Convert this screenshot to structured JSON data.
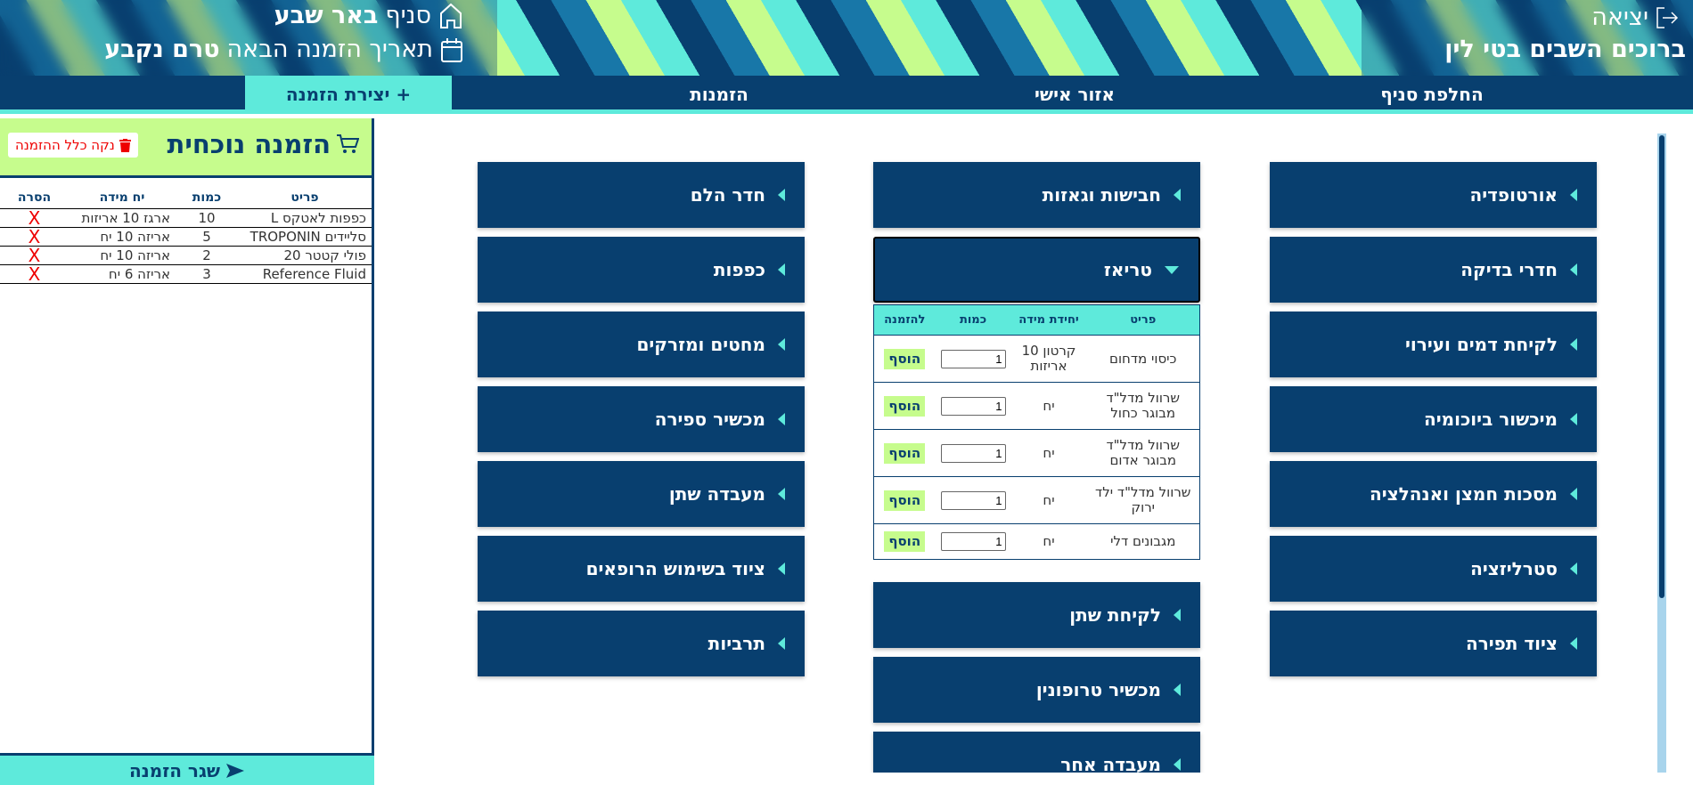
{
  "header": {
    "branch_prefix": "סניף",
    "branch_name": "באר שבע",
    "next_order_label": "תאריך הזמנה הבאה",
    "next_order_value": "טרם נקבע",
    "logout": "יציאה",
    "welcome": "ברוכים השבים בטי לין"
  },
  "nav": {
    "create": "+ יצירת הזמנה",
    "orders": "הזמנות",
    "personal": "אזור אישי",
    "switch_branch": "החלפת סניף"
  },
  "sidebar": {
    "title": "הזמנה נוכחית",
    "clear": "נקה כלל ההזמנה",
    "headers": [
      "פריט",
      "כמות",
      "יח מידה",
      "הסרה"
    ],
    "rows": [
      {
        "item": "כפפות לאטקס L",
        "qty": "10",
        "unit": "ארגז 10 אריזות",
        "remove": "X"
      },
      {
        "item": "סליידים TROPONIN",
        "qty": "5",
        "unit": "אריזה 10 יח",
        "remove": "X"
      },
      {
        "item": "פולי קטטר 20",
        "qty": "2",
        "unit": "אריזה 10 יח",
        "remove": "X"
      },
      {
        "item": "Reference Fluid",
        "qty": "3",
        "unit": "אריזה 6 יח",
        "remove": "X"
      }
    ],
    "send": "שגר הזמנה"
  },
  "categories": {
    "right": [
      "אורטופדיה",
      "חדרי בדיקה",
      "לקיחת דמים ועירוי",
      "מיכשור ביוכומיה",
      "מסכות חמצן ואנהלציה",
      "סטרליזציה",
      "ציוד תפירה"
    ],
    "middle": [
      "חבישות וגאזות",
      "טריאז",
      "לקיחת שתן",
      "מכשיר טרופונין",
      "מעבדה אחר"
    ],
    "left": [
      "חדר הלם",
      "כפפות",
      "מחטים ומזרקים",
      "מכשיר ספירה",
      "מעבדה שתן",
      "ציוד בשימוש הרופאים",
      "תרביות"
    ]
  },
  "triage": {
    "headers": [
      "פריט",
      "יחידת מידה",
      "כמות",
      "להזמנה"
    ],
    "add_label": "הוסף",
    "rows": [
      {
        "item": "כיסוי מדחום",
        "unit": "קרטון 10 אריזות",
        "qty": "1"
      },
      {
        "item": "שרוול מדל\"ד מבוגר כחול",
        "unit": "יח",
        "qty": "1"
      },
      {
        "item": "שרוול מדל\"ד מבוגר אדום",
        "unit": "יח",
        "qty": "1"
      },
      {
        "item": "שרוול מדל\"ד ילד ירוק",
        "unit": "יח",
        "qty": "1"
      },
      {
        "item": "מגבונים דלי",
        "unit": "יח",
        "qty": "1"
      }
    ]
  }
}
